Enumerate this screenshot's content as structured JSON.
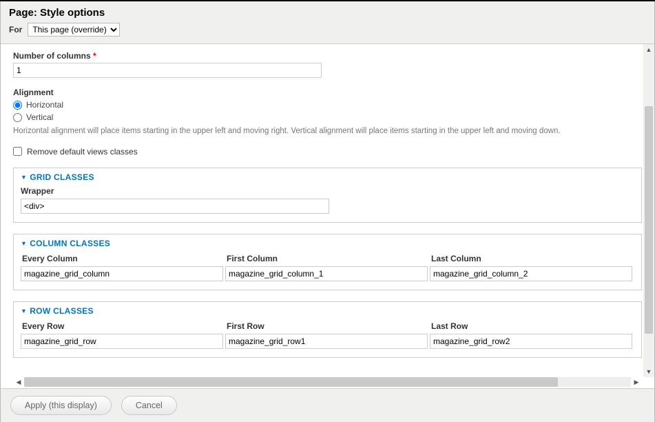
{
  "header": {
    "title": "Page: Style options",
    "for_label": "For",
    "for_selected": "This page (override)"
  },
  "fields": {
    "num_columns_label": "Number of columns",
    "num_columns_value": "1",
    "alignment_label": "Alignment",
    "align_horizontal": "Horizontal",
    "align_vertical": "Vertical",
    "align_desc": "Horizontal alignment will place items starting in the upper left and moving right. Vertical alignment will place items starting in the upper left and moving down.",
    "remove_classes_label": "Remove default views classes"
  },
  "grid": {
    "legend": "GRID CLASSES",
    "wrapper_label": "Wrapper",
    "wrapper_value": "<div>"
  },
  "column": {
    "legend": "COLUMN CLASSES",
    "h_every": "Every Column",
    "h_first": "First Column",
    "h_last": "Last Column",
    "v_every": "magazine_grid_column",
    "v_first": "magazine_grid_column_1",
    "v_last": "magazine_grid_column_2"
  },
  "row": {
    "legend": "ROW CLASSES",
    "h_every": "Every Row",
    "h_first": "First Row",
    "h_last": "Last Row",
    "v_every": "magazine_grid_row",
    "v_first": "magazine_grid_row1",
    "v_last": "magazine_grid_row2"
  },
  "footer": {
    "apply": "Apply (this display)",
    "cancel": "Cancel"
  }
}
